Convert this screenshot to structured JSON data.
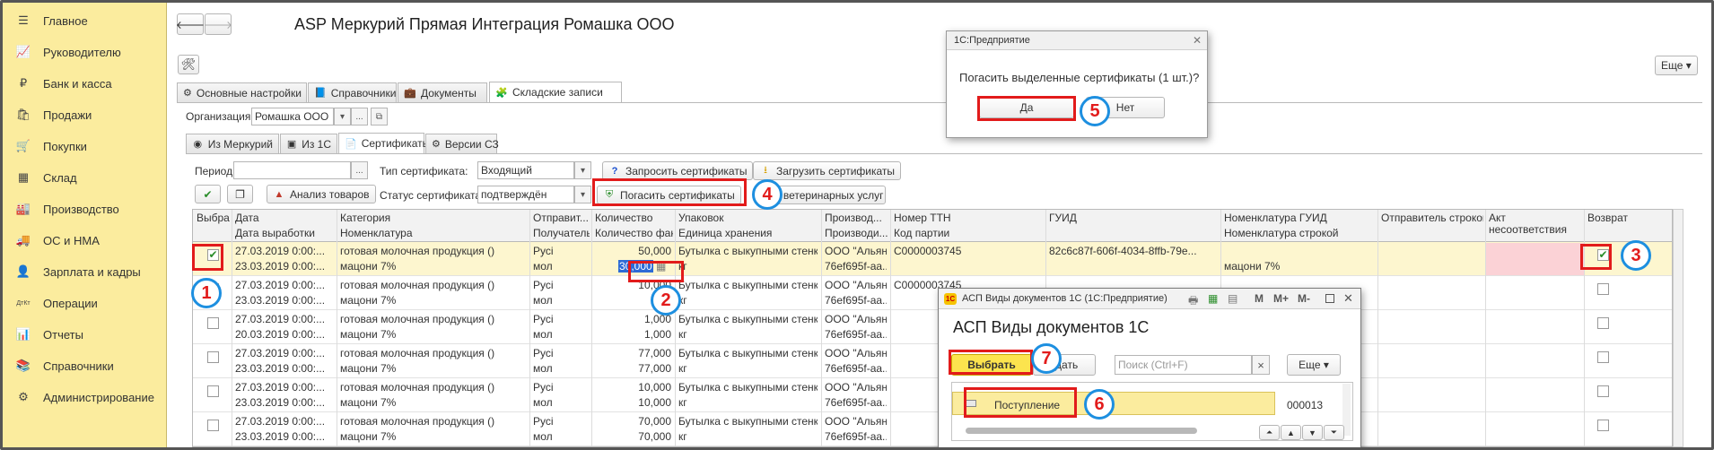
{
  "sidebar": {
    "items": [
      {
        "label": "Главное",
        "icon": "menu-icon",
        "glyph": "☰"
      },
      {
        "label": "Руководителю",
        "icon": "chart-up-icon",
        "glyph": "📈"
      },
      {
        "label": "Банк и касса",
        "icon": "coin-icon",
        "glyph": "₽"
      },
      {
        "label": "Продажи",
        "icon": "cart-icon",
        "glyph": "🛍"
      },
      {
        "label": "Покупки",
        "icon": "basket-icon",
        "glyph": "🛒"
      },
      {
        "label": "Склад",
        "icon": "warehouse-icon",
        "glyph": "▦"
      },
      {
        "label": "Производство",
        "icon": "factory-icon",
        "glyph": "🏭"
      },
      {
        "label": "ОС и НМА",
        "icon": "truck-icon",
        "glyph": "🚚"
      },
      {
        "label": "Зарплата и кадры",
        "icon": "person-icon",
        "glyph": "👤"
      },
      {
        "label": "Операции",
        "icon": "dt-kt-icon",
        "glyph": "ДтКт"
      },
      {
        "label": "Отчеты",
        "icon": "bar-chart-icon",
        "glyph": "📊"
      },
      {
        "label": "Справочники",
        "icon": "book-icon",
        "glyph": "📚"
      },
      {
        "label": "Администрирование",
        "icon": "gear-icon",
        "glyph": "⚙"
      }
    ]
  },
  "header": {
    "title": "ASP Меркурий Прямая Интеграция Ромашка ООО",
    "back_glyph": "🡐",
    "forward_glyph": "🡒",
    "more_label": "Еще ▾",
    "tool_icon": "tools-icon"
  },
  "main_tabs": [
    {
      "label": "Основные настройки",
      "icon": "gear-icon"
    },
    {
      "label": "Справочники",
      "icon": "book-icon"
    },
    {
      "label": "Документы",
      "icon": "briefcase-icon"
    },
    {
      "label": "Складские записи",
      "icon": "blocks-icon"
    }
  ],
  "org": {
    "label": "Организация:",
    "value": "Ромашка ООО",
    "btn1": "▾",
    "btn2": "...",
    "btn3": "⧉"
  },
  "sub_tabs": [
    {
      "label": "Из Меркурий"
    },
    {
      "label": "Из 1С"
    },
    {
      "label": "Сертификаты"
    },
    {
      "label": "Версии СЗ"
    }
  ],
  "filters": {
    "period_label": "Период:",
    "period_value": "",
    "period_btn": "...",
    "cert_type_label": "Тип сертификата:",
    "cert_type_value": "Входящий",
    "cert_status_label": "Статус сертификата:",
    "cert_status_value": "подтверждён",
    "dropdown_glyph": "▾"
  },
  "toolbar": {
    "request_certs": "Запросить сертификаты",
    "load_certs": "Загрузить сертификаты",
    "analysis": "Анализ товаров",
    "repay_certs": "Погасить сертификаты",
    "vet_services": "т ветеринарных услуг"
  },
  "grid": {
    "headers_top": [
      "Выбран",
      "Дата",
      "Категория",
      "Отправит...",
      "Количество",
      "Упаковок",
      "Производ...",
      "Номер ТТН",
      "ГУИД",
      "Номенклатура ГУИД",
      "Отправитель строкой",
      "Акт несоответствия",
      "Возврат"
    ],
    "headers_bottom": [
      "",
      "Дата выработки",
      "Номенклатура",
      "Получатель",
      "Количество факт",
      "Единица хранения",
      "Производи...",
      "Код партии",
      "",
      "Номенклатура строкой",
      "",
      "",
      ""
    ],
    "rows": [
      {
        "checked": true,
        "date": "27.03.2019 0:00:...",
        "category": "готовая молочная продукция ()",
        "sender": "Русі",
        "qty": "50,000",
        "pack": "Бутылка с выкупными стенка...",
        "producer": "ООО \"Альяна...",
        "ttn": "C0000003745",
        "guid": "82c6c87f-606f-4034-8ffb-79e...",
        "nom_guid": "",
        "return": true,
        "date2": "23.03.2019 0:00:...",
        "nom": "мацони 7%",
        "recipient": "мол",
        "qty_fact": "30,000",
        "unit": "кг",
        "producer2": "76ef695f-aa...",
        "batch": "",
        "nom_str": "мацони 7%"
      },
      {
        "checked": false,
        "date": "27.03.2019 0:00:...",
        "category": "готовая молочная продукция ()",
        "sender": "Русі",
        "qty": "10,000",
        "pack": "Бутылка с выкупными стенка...",
        "producer": "ООО \"Альяна...",
        "ttn": "C0000003745",
        "guid": "",
        "nom_guid": "",
        "return": false,
        "date2": "23.03.2019 0:00:...",
        "nom": "мацони 7%",
        "recipient": "мол",
        "qty_fact": "",
        "unit": "кг",
        "producer2": "76ef695f-aa...",
        "batch": "",
        "nom_str": ""
      },
      {
        "checked": false,
        "date": "27.03.2019 0:00:...",
        "category": "готовая молочная продукция ()",
        "sender": "Русі",
        "qty": "1,000",
        "pack": "Бутылка с выкупными стенка...",
        "producer": "ООО \"Альяна...",
        "ttn": "",
        "guid": "",
        "nom_guid": "",
        "return": false,
        "date2": "20.03.2019 0:00:...",
        "nom": "мацони 7%",
        "recipient": "мол",
        "qty_fact": "1,000",
        "unit": "кг",
        "producer2": "76ef695f-aa...",
        "batch": "",
        "nom_str": ""
      },
      {
        "checked": false,
        "date": "27.03.2019 0:00:...",
        "category": "готовая молочная продукция ()",
        "sender": "Русі",
        "qty": "77,000",
        "pack": "Бутылка с выкупными стенка...",
        "producer": "ООО \"Альяна...",
        "ttn": "",
        "guid": "",
        "nom_guid": "",
        "return": false,
        "date2": "23.03.2019 0:00:...",
        "nom": "мацони 7%",
        "recipient": "мол",
        "qty_fact": "77,000",
        "unit": "кг",
        "producer2": "76ef695f-aa...",
        "batch": "",
        "nom_str": ""
      },
      {
        "checked": false,
        "date": "27.03.2019 0:00:...",
        "category": "готовая молочная продукция ()",
        "sender": "Русі",
        "qty": "10,000",
        "pack": "Бутылка с выкупными стенка...",
        "producer": "ООО \"Альяна...",
        "ttn": "",
        "guid": "",
        "nom_guid": "",
        "return": false,
        "date2": "23.03.2019 0:00:...",
        "nom": "мацони 7%",
        "recipient": "мол",
        "qty_fact": "10,000",
        "unit": "кг",
        "producer2": "76ef695f-aa...",
        "batch": "",
        "nom_str": ""
      },
      {
        "checked": false,
        "date": "27.03.2019 0:00:...",
        "category": "готовая молочная продукция ()",
        "sender": "Русі",
        "qty": "70,000",
        "pack": "Бутылка с выкупными стенка...",
        "producer": "ООО \"Альяна...",
        "ttn": "",
        "guid": "",
        "nom_guid": "",
        "return": false,
        "date2": "23.03.2019 0:00:...",
        "nom": "мацони 7%",
        "recipient": "мол",
        "qty_fact": "70,000",
        "unit": "кг",
        "producer2": "76ef695f-aa...",
        "batch": "",
        "nom_str": ""
      }
    ]
  },
  "confirm_dialog": {
    "title": "1С:Предприятие",
    "message": "Погасить выделенные сертификаты (1 шт.)?",
    "yes": "Да",
    "no": "Нет",
    "close_glyph": "✕"
  },
  "doc_types_dialog": {
    "window_title": "АСП Виды документов 1С  (1С:Предприятие)",
    "heading": "АСП Виды документов 1С",
    "choose": "Выбрать",
    "create": "здать",
    "search_placeholder": "Поиск (Ctrl+F)",
    "clear_glyph": "×",
    "more": "Еще ▾",
    "title_icons": [
      "M",
      "M+",
      "M-"
    ],
    "row_label": "Поступление",
    "row_code": "000013",
    "nav_glyphs": [
      "⏶",
      "▲",
      "▼",
      "⏷"
    ]
  },
  "markers": [
    "1",
    "2",
    "3",
    "4",
    "5",
    "6",
    "7"
  ],
  "colors": {
    "sidebar": "#fbec9e",
    "selected_row": "#fdf6cf",
    "accent_red": "#e21b1b",
    "marker_blue": "#1d8fe0",
    "primary_btn": "#fce44e"
  }
}
